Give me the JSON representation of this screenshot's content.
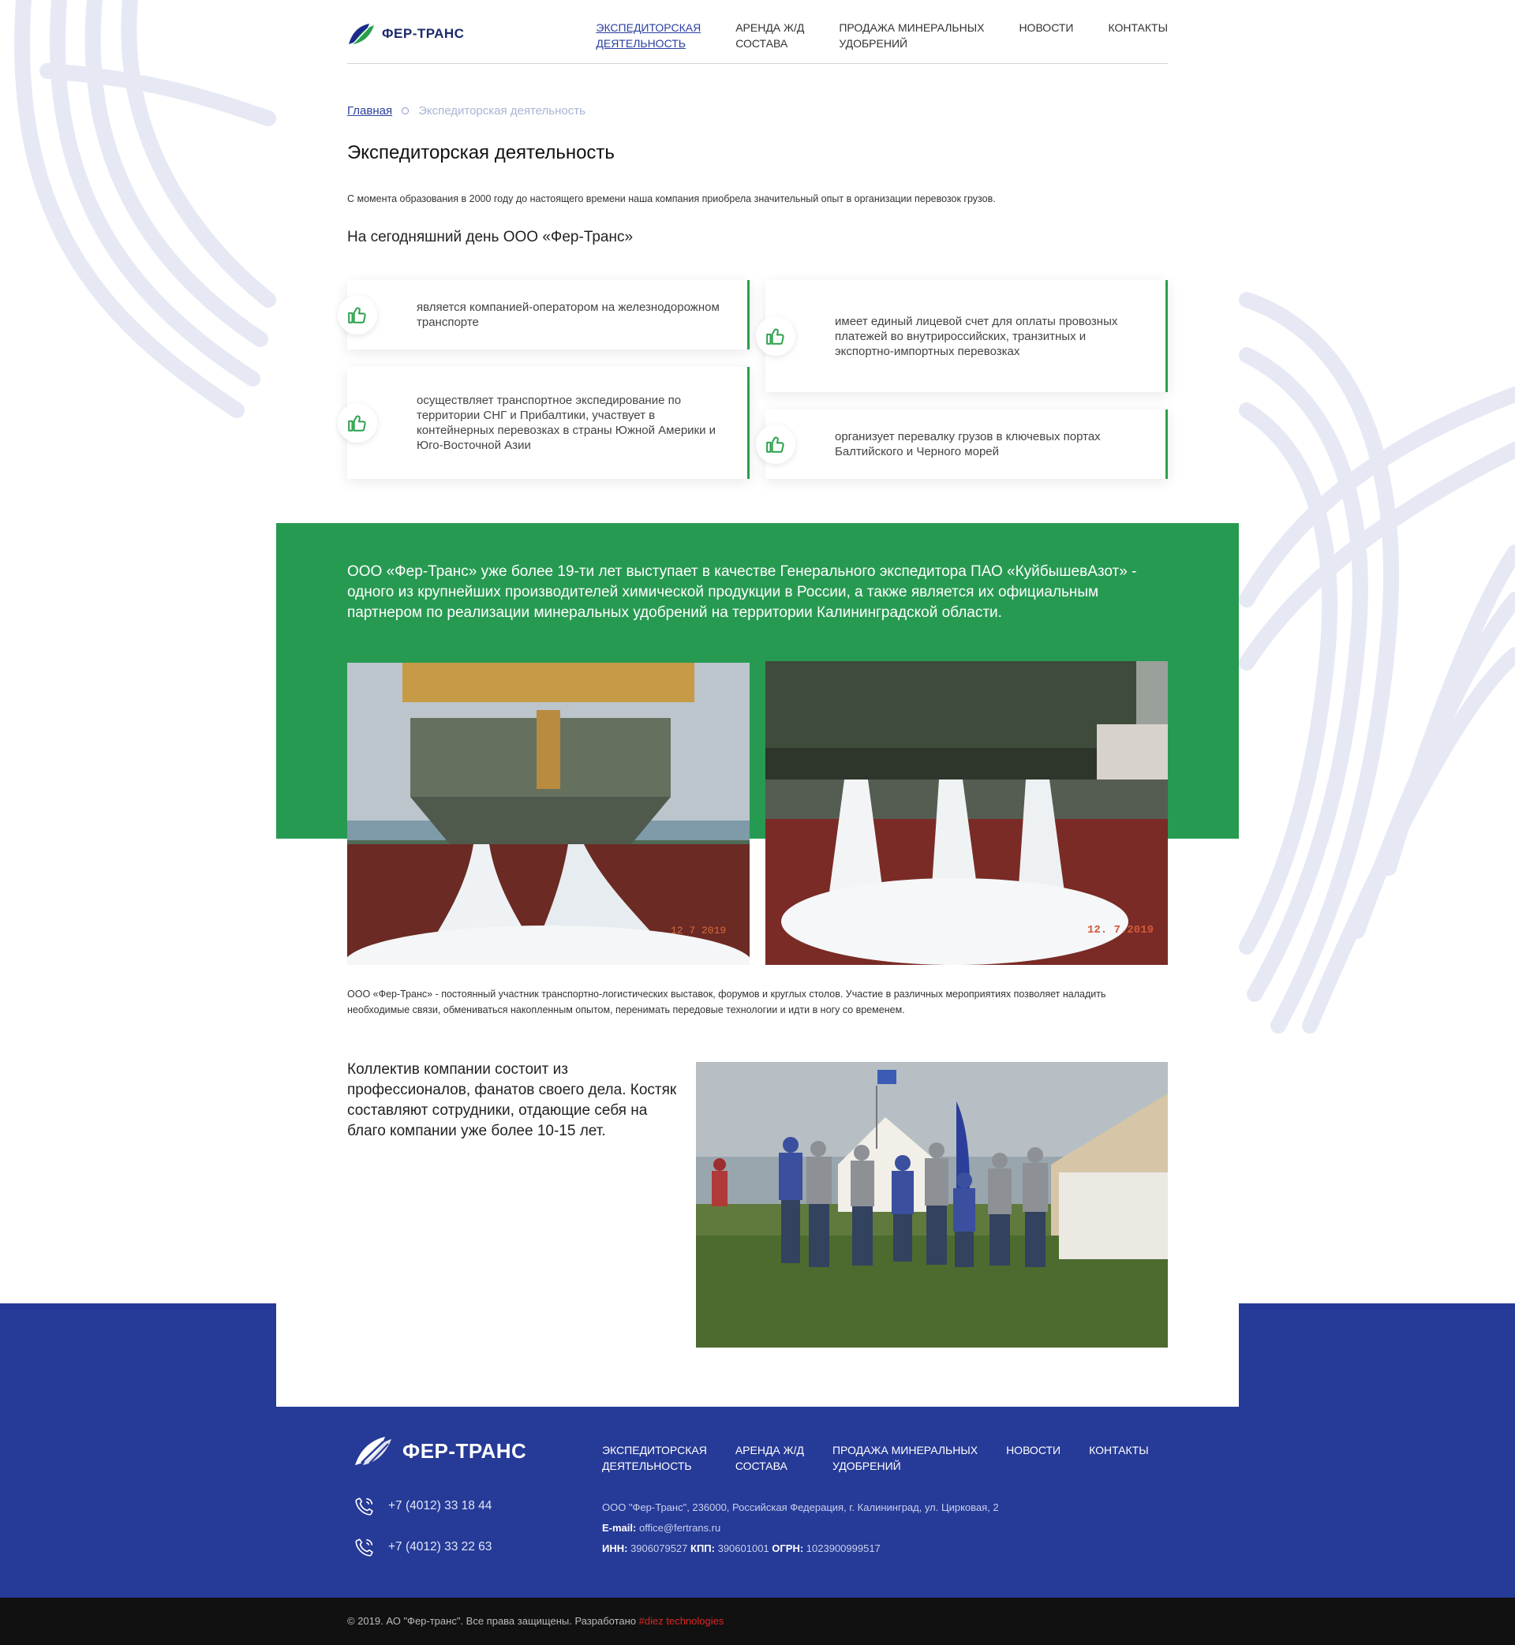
{
  "brand": {
    "name": "ФЕР-ТРАНС",
    "colors": {
      "blue": "#263a97",
      "green": "#279a52",
      "accent_link": "#2b3fa0"
    }
  },
  "nav": [
    {
      "label": "ЭКСПЕДИТОРСКАЯ\nДЕЯТЕЛЬНОСТЬ",
      "line1": "ЭКСПЕДИТОРСКАЯ",
      "line2": "ДЕЯТЕЛЬНОСТЬ",
      "active": true
    },
    {
      "label": "АРЕНДА Ж/Д СОСТАВА",
      "line1": "АРЕНДА Ж/Д",
      "line2": "СОСТАВА",
      "active": false
    },
    {
      "label": "ПРОДАЖА МИНЕРАЛЬНЫХ УДОБРЕНИЙ",
      "line1": "ПРОДАЖА МИНЕРАЛЬНЫХ",
      "line2": "УДОБРЕНИЙ",
      "active": false
    },
    {
      "label": "НОВОСТИ",
      "line1": "НОВОСТИ",
      "line2": "",
      "active": false
    },
    {
      "label": "КОНТАКТЫ",
      "line1": "КОНТАКТЫ",
      "line2": "",
      "active": false
    }
  ],
  "breadcrumb": {
    "home": "Главная",
    "current": "Экспедиторская деятельность"
  },
  "page_title": "Экспедиторская деятельность",
  "intro": "С момента образования в 2000 году до настоящего времени наша компания приобрела значительный опыт в организации перевозок грузов.",
  "subtitle": "На сегодняшний день ООО «Фер-Транс»",
  "features": [
    {
      "text": "является компанией-оператором на железнодорожном транспорте",
      "icon": "thumbs-up-icon"
    },
    {
      "text": "имеет единый лицевой счет для оплаты провозных платежей во внутрироссийских, транзитных и экспортно-импортных перевозках",
      "icon": "thumbs-up-icon"
    },
    {
      "text": "осуществляет транспортное экспедирование по территории СНГ и Прибалтики, участвует в контейнерных перевозках в страны Южной Америки и Юго-Восточной Азии",
      "icon": "thumbs-up-icon"
    },
    {
      "text": "организует перевалку грузов в ключевых портах Балтийского и Черного морей",
      "icon": "thumbs-up-icon"
    }
  ],
  "green_text": "ООО «Фер-Транс» уже более 19-ти лет выступает в качестве Генерального экспедитора ПАО «КуйбышевАзот» - одного из крупнейших производителей химической продукции в России, а также является их официальным партнером по реализации минеральных удобрений на территории Калининградской области.",
  "photos": {
    "left_date": "12  7 2019",
    "right_date": "12.  7.2019"
  },
  "para2": "ООО «Фер-Транс» - постоянный участник транспортно-логистических выставок, форумов и круглых столов. Участие в различных мероприятиях позволяет наладить необходимые связи, обмениваться накопленным опытом, перенимать передовые технологии и идти в ногу со временем.",
  "team_text": "Коллектив компании состоит из профессионалов, фанатов своего дела. Костяк составляют сотрудники, отдающие себя на благо компании уже более 10-15 лет.",
  "footer": {
    "phones": [
      "+7 (4012) 33 18 44",
      "+7 (4012) 33 22 63"
    ],
    "address": "ООО \"Фер-Транс\", 236000, Российская Федерация, г. Калининград, ул. Цирковая, 2",
    "email_label": "E-mail:",
    "email": "office@fertrans.ru",
    "inn_label": "ИНН:",
    "inn": "3906079527",
    "kpp_label": "КПП:",
    "kpp": "390601001",
    "ogrn_label": "ОГРН:",
    "ogrn": "1023900999517"
  },
  "copyright": {
    "text": "© 2019. АО \"Фер-транс\". Все права защищены. Разработано",
    "developer": "#diez technologies"
  }
}
